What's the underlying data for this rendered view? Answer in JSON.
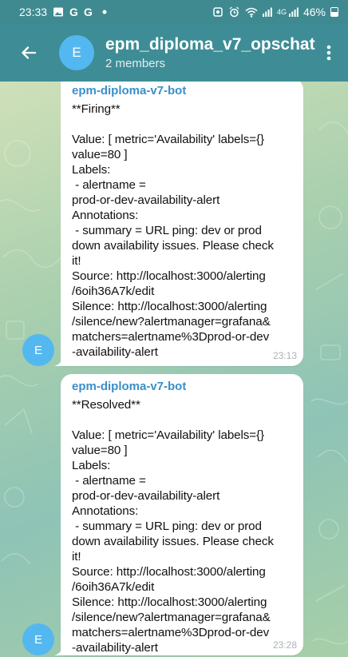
{
  "status_bar": {
    "time": "23:33",
    "notification_icons": [
      "image-icon",
      "google-icon",
      "google-icon",
      "dot-icon"
    ],
    "notif_letter": "G",
    "battery_text": "46%",
    "network_label": "4G"
  },
  "header": {
    "avatar_letter": "E",
    "title": "epm_diploma_v7_opschat",
    "subtitle": "2 members"
  },
  "colors": {
    "header_bg": "#3e8d96",
    "status_bg": "#3f8a91",
    "avatar_bg": "#54b8f0",
    "sender_name": "#3a8fc9",
    "bubble_bg": "#ffffff"
  },
  "messages": [
    {
      "avatar_letter": "E",
      "sender": "epm-diploma-v7-bot",
      "text": "**Firing**\n\nValue: [ metric='Availability' labels={}\nvalue=80 ]\nLabels:\n - alertname =\nprod-or-dev-availability-alert\nAnnotations:\n - summary = URL ping: dev or prod\ndown availability issues. Please check\nit!\nSource: http://localhost:3000/alerting\n/6oih36A7k/edit\nSilence: http://localhost:3000/alerting\n/silence/new?alertmanager=grafana&\nmatchers=alertname%3Dprod-or-dev\n-availability-alert",
      "time": "23:13"
    },
    {
      "avatar_letter": "E",
      "sender": "epm-diploma-v7-bot",
      "text": "**Resolved**\n\nValue: [ metric='Availability' labels={}\nvalue=80 ]\nLabels:\n - alertname =\nprod-or-dev-availability-alert\nAnnotations:\n - summary = URL ping: dev or prod\ndown availability issues. Please check\nit!\nSource: http://localhost:3000/alerting\n/6oih36A7k/edit\nSilence: http://localhost:3000/alerting\n/silence/new?alertmanager=grafana&\nmatchers=alertname%3Dprod-or-dev\n-availability-alert",
      "time": "23:28"
    }
  ]
}
